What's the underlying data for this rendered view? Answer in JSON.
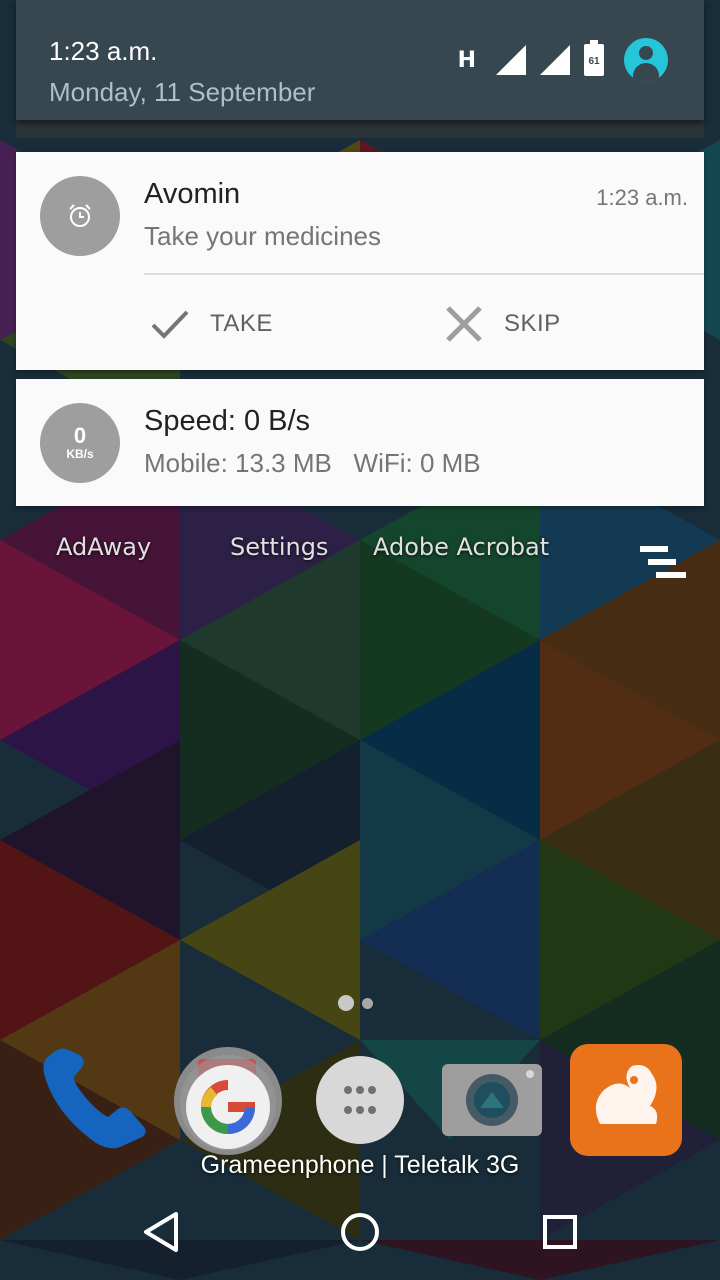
{
  "status": {
    "time": "1:23 a.m.",
    "date": "Monday, 11 September",
    "network_type": "H",
    "battery_level": "61",
    "icons": [
      "signal-1-icon",
      "signal-2-icon",
      "battery-icon",
      "user-avatar-icon"
    ]
  },
  "notifications": [
    {
      "title": "Avomin",
      "text": "Take your medicines",
      "time": "1:23 a.m.",
      "icon": "alarm-clock-icon",
      "actions": [
        {
          "label": "TAKE",
          "icon": "check-icon"
        },
        {
          "label": "SKIP",
          "icon": "close-icon"
        }
      ]
    },
    {
      "title": "Speed: 0 B/s",
      "text": "Mobile: 13.3 MB   WiFi: 0 MB",
      "badge_value": "0",
      "badge_unit": "KB/s"
    }
  ],
  "home": {
    "apps": [
      "AdAway",
      "Settings",
      "Adobe Acrobat"
    ],
    "dock": [
      "phone-icon",
      "google-icon",
      "app-drawer-icon",
      "camera-icon",
      "uc-browser-icon"
    ],
    "carrier": "Grameenphone | Teletalk 3G"
  },
  "nav": [
    "back-icon",
    "home-icon",
    "recents-icon"
  ],
  "colors": {
    "header": "#37474f",
    "card": "#fafafa",
    "avatar": "#26c6da"
  }
}
